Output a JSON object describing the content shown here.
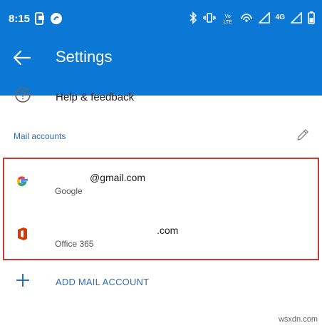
{
  "status_bar": {
    "time": "8:15",
    "network": "4G",
    "lte_label": "Vo LTE"
  },
  "toolbar": {
    "title": "Settings"
  },
  "help": {
    "label": "Help & feedback"
  },
  "mail_section": {
    "title": "Mail accounts"
  },
  "accounts": [
    {
      "email": "@gmail.com",
      "provider": "Google",
      "icon": "google-icon"
    },
    {
      "email": ".com",
      "provider": "Office 365",
      "icon": "office-icon"
    }
  ],
  "add_account": {
    "label": "ADD MAIL ACCOUNT"
  },
  "watermark": "wsxdn.com",
  "colors": {
    "header": "#0a78d4",
    "highlight_border": "#c43b3b",
    "link": "#2b6fb7"
  }
}
